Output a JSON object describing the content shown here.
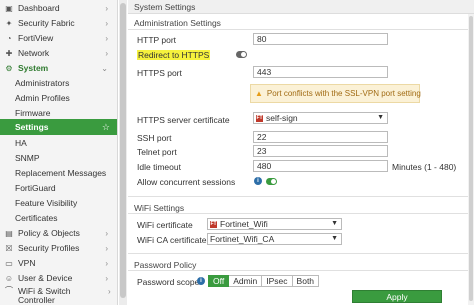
{
  "sidebar": {
    "items": [
      {
        "label": "Dashboard",
        "icon": "dashboard-icon",
        "glyph": "▣"
      },
      {
        "label": "Security Fabric",
        "icon": "security-fabric-icon",
        "glyph": "✦"
      },
      {
        "label": "FortiView",
        "icon": "fortiview-icon",
        "glyph": "◔"
      },
      {
        "label": "Network",
        "icon": "network-icon",
        "glyph": "✚"
      },
      {
        "label": "System",
        "icon": "gear-icon",
        "glyph": "⚙"
      },
      {
        "label": "Administrators"
      },
      {
        "label": "Admin Profiles"
      },
      {
        "label": "Firmware"
      },
      {
        "label": "Settings"
      },
      {
        "label": "HA"
      },
      {
        "label": "SNMP"
      },
      {
        "label": "Replacement Messages"
      },
      {
        "label": "FortiGuard"
      },
      {
        "label": "Feature Visibility"
      },
      {
        "label": "Certificates"
      },
      {
        "label": "Policy & Objects",
        "icon": "policy-icon",
        "glyph": "▤"
      },
      {
        "label": "Security Profiles",
        "icon": "lock-icon",
        "glyph": "☒"
      },
      {
        "label": "VPN",
        "icon": "vpn-icon",
        "glyph": "▭"
      },
      {
        "label": "User & Device",
        "icon": "user-icon",
        "glyph": "☺"
      },
      {
        "label": "WiFi & Switch Controller",
        "icon": "wifi-icon",
        "glyph": "⌒"
      }
    ]
  },
  "header": {
    "title": "System Settings"
  },
  "admin": {
    "title": "Administration Settings",
    "http_port_label": "HTTP port",
    "http_port_value": "80",
    "redirect_label": "Redirect to HTTPS",
    "https_port_label": "HTTPS port",
    "https_port_value": "443",
    "warning": "Port conflicts with the SSL-VPN port setting",
    "https_cert_label": "HTTPS server certificate",
    "https_cert_value": "self-sign",
    "ssh_label": "SSH port",
    "ssh_value": "22",
    "telnet_label": "Telnet port",
    "telnet_value": "23",
    "idle_label": "Idle timeout",
    "idle_value": "480",
    "idle_suffix": "Minutes (1 - 480)",
    "concurrent_label": "Allow concurrent sessions"
  },
  "wifi": {
    "title": "WiFi Settings",
    "cert_label": "WiFi certificate",
    "cert_value": "Fortinet_Wifi",
    "ca_label": "WiFi CA certificate",
    "ca_value": "Fortinet_Wifi_CA"
  },
  "password": {
    "title": "Password Policy",
    "scope_label": "Password scope",
    "options": [
      "Off",
      "Admin",
      "IPsec",
      "Both"
    ],
    "selected": "Off"
  },
  "apply_label": "Apply",
  "colors": {
    "accent": "#3a9b3f",
    "highlight": "#f6f23d",
    "warning_bg": "#fbf1d6"
  }
}
